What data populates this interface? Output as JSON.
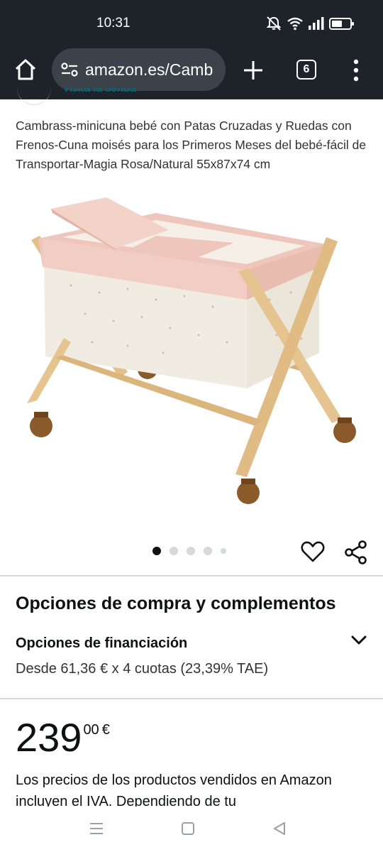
{
  "status_bar": {
    "time": "10:31",
    "icons": [
      "mute-icon",
      "wifi-icon",
      "signal-icon",
      "battery-icon"
    ]
  },
  "browser": {
    "url": "amazon.es/Camb",
    "tab_count": "6",
    "icons": [
      "home-icon",
      "site-settings-icon",
      "plus-icon",
      "tabs-icon",
      "more-vert-icon"
    ]
  },
  "store": {
    "link_text": "Visita la tienda"
  },
  "product": {
    "title": "Cambrass-minicuna bebé con Patas Cruzadas y Ruedas con Frenos-Cuna moisés para los Primeros Meses del bebé-fácil de Transportar-Magia Rosa/Natural 55x87x74 cm",
    "image_icon": "crib-photo",
    "gallery": {
      "count": 5,
      "active_index": 0
    }
  },
  "purchase": {
    "section_title": "Opciones de compra y complementos",
    "financing_title": "Opciones de financiación",
    "financing_detail": "Desde 61,36 € x 4 cuotas (23,39% TAE)"
  },
  "price": {
    "whole": "239",
    "fraction": "00",
    "currency": "€"
  },
  "tax_note": "Los precios de los productos vendidos en Amazon incluyen el IVA. Dependiendo de tu",
  "colors": {
    "chrome": "#1d2329",
    "urlbar": "#3b4249",
    "text": "#0f1111",
    "link": "#007185",
    "divider": "#d5d9d9"
  }
}
